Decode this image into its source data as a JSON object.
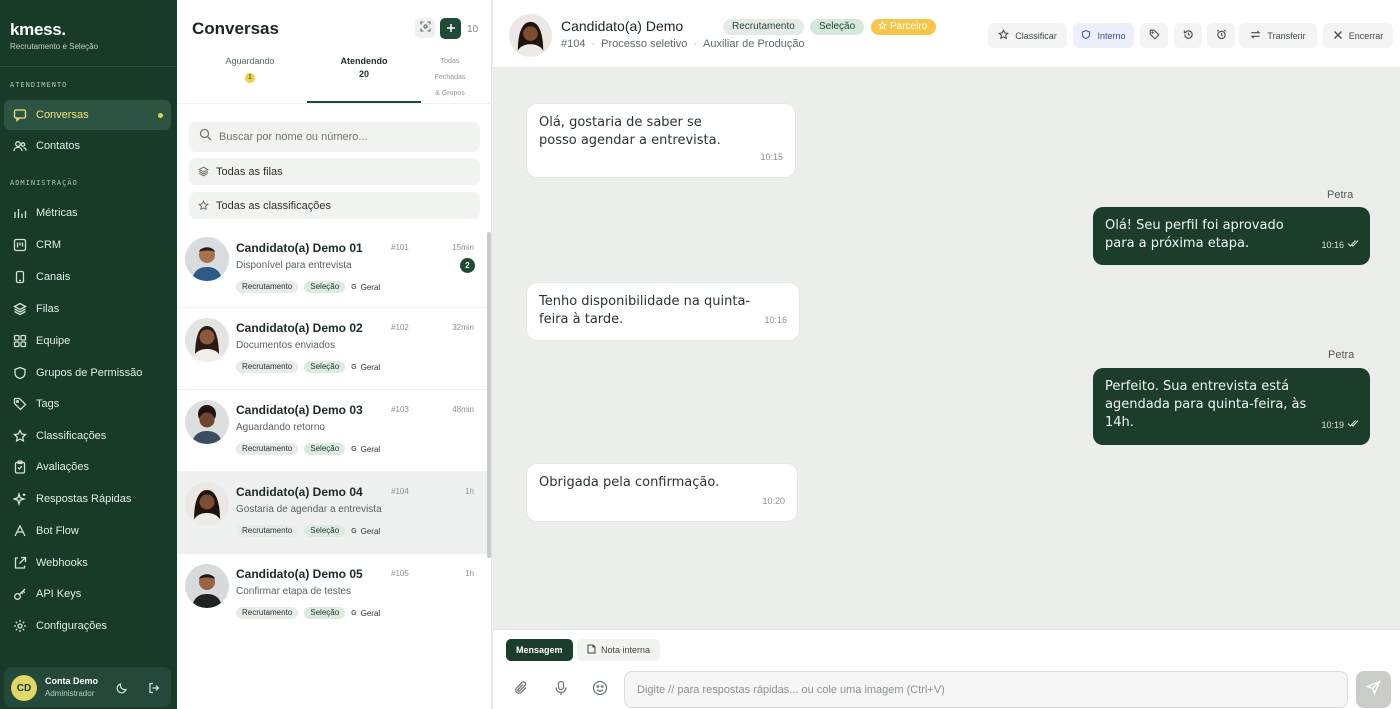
{
  "brand": {
    "name": "kmess.",
    "subtitle": "Recrutamento e Seleção"
  },
  "sidebar": {
    "section_attendance": "ATENDIMENTO",
    "section_admin": "ADMINISTRAÇÃO",
    "items": [
      {
        "label": "Conversas",
        "icon": "chat-icon",
        "active": true
      },
      {
        "label": "Contatos",
        "icon": "users-icon"
      },
      {
        "label": "Métricas",
        "icon": "chart-icon"
      },
      {
        "label": "CRM",
        "icon": "kanban-icon"
      },
      {
        "label": "Canais",
        "icon": "phone-icon"
      },
      {
        "label": "Filas",
        "icon": "layers-icon"
      },
      {
        "label": "Equipe",
        "icon": "grid-icon"
      },
      {
        "label": "Grupos de Permissão",
        "icon": "shield-icon"
      },
      {
        "label": "Tags",
        "icon": "tag-icon"
      },
      {
        "label": "Classificações",
        "icon": "star-icon"
      },
      {
        "label": "Avaliações",
        "icon": "clipboard-icon"
      },
      {
        "label": "Respostas Rápidas",
        "icon": "sparkle-icon"
      },
      {
        "label": "Bot Flow",
        "icon": "bot-icon"
      },
      {
        "label": "Webhooks",
        "icon": "webhook-icon"
      },
      {
        "label": "API Keys",
        "icon": "key-icon"
      },
      {
        "label": "Configurações",
        "icon": "gear-icon"
      }
    ],
    "user": {
      "initials": "CD",
      "name": "Conta Demo",
      "role": "Administrador"
    }
  },
  "conversations_panel": {
    "title": "Conversas",
    "count": "10",
    "tabs": [
      {
        "label": "Aguardando",
        "count": "1"
      },
      {
        "label": "Atendendo",
        "count": "20",
        "active": true
      },
      {
        "label": "Todas",
        "label2": "Fechadas",
        "label3": "& Grupos"
      }
    ],
    "search_placeholder": "Buscar por nome ou número...",
    "filter_queues": "Todas as filas",
    "filter_classifications": "Todas as classificações",
    "items": [
      {
        "name": "Candidato(a) Demo 01",
        "id": "#101",
        "time": "15min",
        "preview": "Disponível para entrevista",
        "unread": "2",
        "tags": [
          "Recrutamento",
          "Seleção"
        ],
        "group": "Geral",
        "group_letter": "G"
      },
      {
        "name": "Candidato(a) Demo 02",
        "id": "#102",
        "time": "32min",
        "preview": "Documentos enviados",
        "tags": [
          "Recrutamento",
          "Seleção"
        ],
        "group": "Geral",
        "group_letter": "G"
      },
      {
        "name": "Candidato(a) Demo 03",
        "id": "#103",
        "time": "48min",
        "preview": "Aguardando retorno",
        "tags": [
          "Recrutamento",
          "Seleção"
        ],
        "group": "Geral",
        "group_letter": "G"
      },
      {
        "name": "Candidato(a) Demo 04",
        "id": "#104",
        "time": "1h",
        "preview": "Gostaria de agendar a entrevista",
        "tags": [
          "Recrutamento",
          "Seleção"
        ],
        "group": "Geral",
        "group_letter": "G",
        "active": true
      },
      {
        "name": "Candidato(a) Demo 05",
        "id": "#105",
        "time": "1h",
        "preview": "Confirmar etapa de testes",
        "tags": [
          "Recrutamento",
          "Seleção"
        ],
        "group": "Geral",
        "group_letter": "G"
      }
    ]
  },
  "chat": {
    "contact_name": "Candidato(a) Demo",
    "ticket": "#104",
    "process": "Processo seletivo",
    "role": "Auxiliar de Produção",
    "tags": [
      {
        "label": "Recrutamento",
        "bg": "#e4ebe6",
        "color": "#33423a"
      },
      {
        "label": "Seleção",
        "bg": "#d6e8db",
        "color": "#234532"
      },
      {
        "label": "Parceiro",
        "bg": "#f6c54a",
        "color": "#ffffff"
      }
    ],
    "actions": {
      "classify": "Classificar",
      "internal": "Interno",
      "transfer": "Transferir",
      "close": "Encerrar"
    },
    "messages": [
      {
        "dir": "in",
        "text": "Olá, gostaria de saber se posso agendar a entrevista.",
        "time": "10:15"
      },
      {
        "dir": "out",
        "sender": "Petra",
        "text": "Olá! Seu perfil foi aprovado para a próxima etapa.",
        "time": "10:16"
      },
      {
        "dir": "in",
        "text": "Tenho disponibilidade na quinta-feira à tarde.",
        "time": "10:16"
      },
      {
        "dir": "out",
        "sender": "Petra",
        "text": "Perfeito. Sua entrevista está agendada para quinta-feira, às 14h.",
        "time": "10:19"
      },
      {
        "dir": "in",
        "text": "Obrigada pela confirmação.",
        "time": "10:20"
      }
    ]
  },
  "composer": {
    "tab_message": "Mensagem",
    "tab_note": "Nota interna",
    "placeholder": "Digite // para respostas rápidas... ou cole uma imagem (Ctrl+V)"
  }
}
